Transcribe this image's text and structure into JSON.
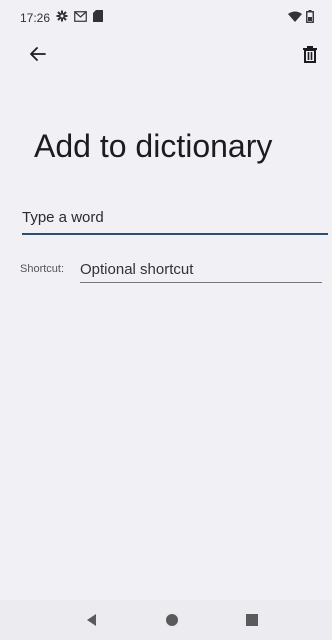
{
  "status_bar": {
    "time": "17:26",
    "left_icons": [
      "gear-icon",
      "gmail-icon",
      "sd-card-icon"
    ],
    "right_icons": [
      "wifi-icon",
      "battery-icon"
    ]
  },
  "toolbar": {
    "back_icon": "arrow-left-icon",
    "delete_icon": "trash-icon"
  },
  "page": {
    "title": "Add to dictionary"
  },
  "form": {
    "word_placeholder": "Type a word",
    "word_value": "",
    "shortcut_label": "Shortcut:",
    "shortcut_placeholder": "Optional shortcut",
    "shortcut_value": ""
  },
  "nav_bar": {
    "buttons": [
      "back-triangle-icon",
      "home-circle-icon",
      "recents-square-icon"
    ]
  },
  "colors": {
    "background": "#f1f0f5",
    "accent_underline": "#2f4e6e"
  }
}
